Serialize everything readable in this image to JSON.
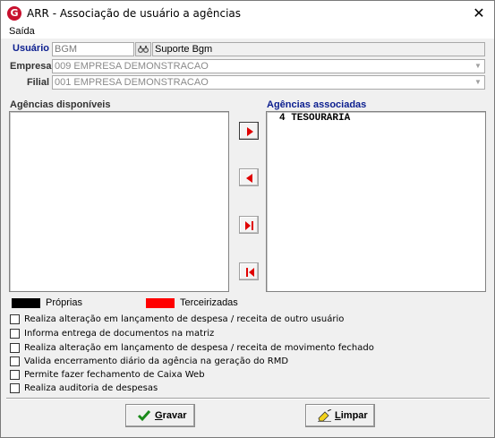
{
  "window": {
    "title": "ARR -  Associação de usuário a agências",
    "app_icon_letter": "G",
    "close_glyph": "✕"
  },
  "menu": {
    "items": [
      "Saída"
    ]
  },
  "form": {
    "usuario": {
      "label": "Usuário",
      "code": "BGM",
      "name": "Suporte Bgm",
      "lookup_icon": "binoculars-icon"
    },
    "empresa": {
      "label": "Empresa",
      "value": "009 EMPRESA DEMONSTRACAO"
    },
    "filial": {
      "label": "Filial",
      "value": "001 EMPRESA DEMONSTRACAO"
    }
  },
  "lists": {
    "available_title": "Agências disponíveis",
    "available_items": [],
    "associated_title": "Agências associadas",
    "associated_items": [
      "4  TESOURARIA"
    ]
  },
  "move_buttons": [
    {
      "name": "move-right-button",
      "icon": "arrow-right-icon"
    },
    {
      "name": "move-left-button",
      "icon": "arrow-left-icon"
    },
    {
      "name": "move-all-right-button",
      "icon": "arrow-all-right-icon"
    },
    {
      "name": "move-all-left-button",
      "icon": "arrow-all-left-icon"
    }
  ],
  "legend": {
    "own": {
      "label": "Próprias",
      "color": "#000000"
    },
    "third": {
      "label": "Terceirizadas",
      "color": "#ff0000"
    }
  },
  "options": [
    {
      "label": "Realiza alteração em lançamento de despesa / receita de outro usuário",
      "checked": false
    },
    {
      "label": "Informa entrega de documentos na matriz",
      "checked": false
    },
    {
      "label": "Realiza alteração em lançamento de despesa / receita de movimento fechado",
      "checked": false
    },
    {
      "label": "Valida encerramento diário da agência na geração do RMD",
      "checked": false
    },
    {
      "label": "Permite fazer fechamento de Caixa Web",
      "checked": false
    },
    {
      "label": "Realiza auditoria de despesas",
      "checked": false
    }
  ],
  "actions": {
    "save": {
      "label": "Gravar",
      "accel": "G",
      "rest": "ravar",
      "icon": "checkmark-icon"
    },
    "clear": {
      "label": "Limpar",
      "accel": "L",
      "rest": "impar",
      "icon": "eraser-icon"
    }
  }
}
